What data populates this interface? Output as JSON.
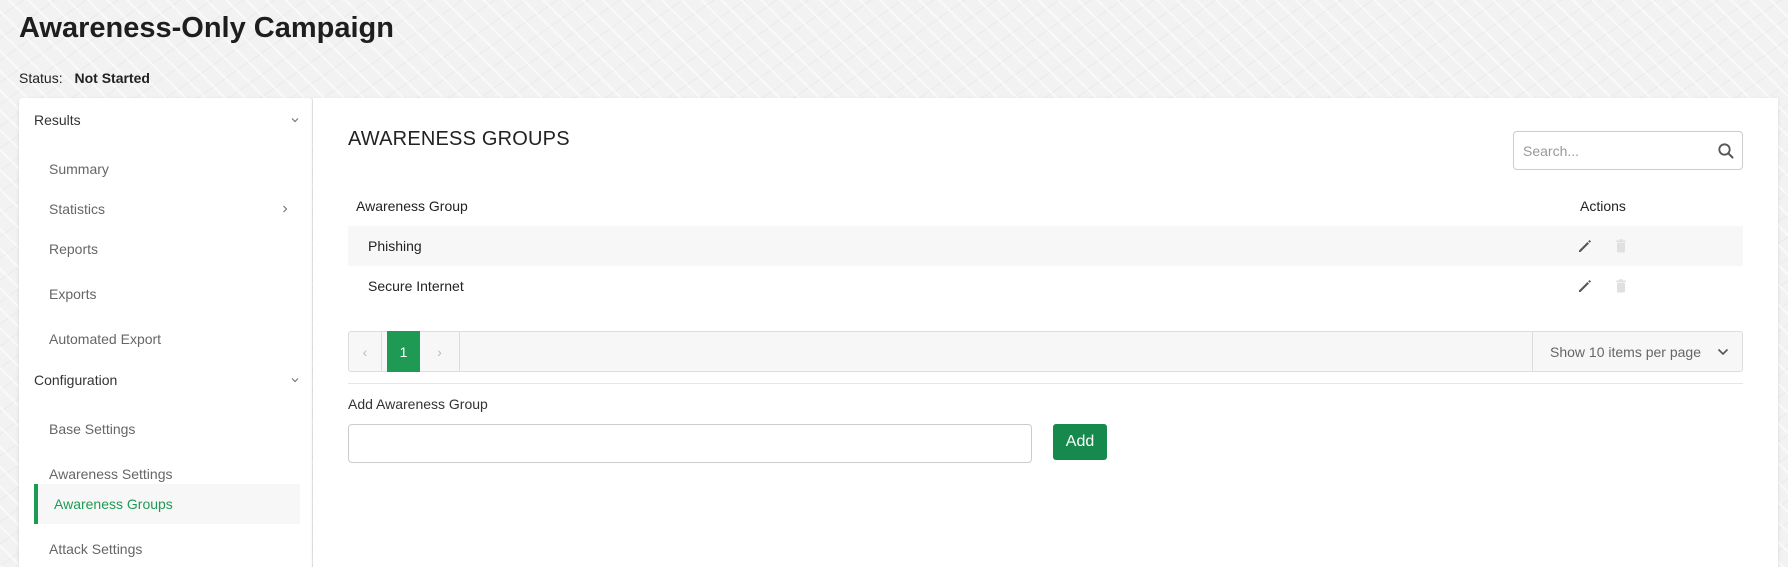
{
  "page": {
    "title": "Awareness-Only Campaign",
    "status_label": "Status:",
    "status_value": "Not Started"
  },
  "sidebar": {
    "groups": [
      {
        "label": "Results",
        "items": [
          {
            "label": "Summary"
          },
          {
            "label": "Statistics",
            "has_submenu": true
          },
          {
            "label": "Reports"
          },
          {
            "label": "Exports"
          },
          {
            "label": "Automated Export"
          }
        ]
      },
      {
        "label": "Configuration",
        "items": [
          {
            "label": "Base Settings"
          },
          {
            "label": "Awareness Settings"
          },
          {
            "label": "Awareness Groups",
            "active": true
          },
          {
            "label": "Attack Settings"
          }
        ]
      }
    ]
  },
  "main": {
    "section_title": "AWARENESS GROUPS",
    "search": {
      "placeholder": "Search...",
      "value": ""
    },
    "table": {
      "columns": [
        "Awareness Group",
        "Actions"
      ],
      "rows": [
        {
          "name": "Phishing"
        },
        {
          "name": "Secure Internet"
        }
      ]
    },
    "pagination": {
      "prev": "‹",
      "current_page": "1",
      "next": "›",
      "page_size_label": "Show 10 items per page"
    },
    "add_form": {
      "label": "Add Awareness Group",
      "input_value": "",
      "button_label": "Add"
    }
  },
  "colors": {
    "accent": "#1f9a55",
    "button": "#158a4c"
  },
  "icons": {
    "search": "search-icon",
    "edit": "pencil-icon",
    "delete": "trash-icon",
    "chevron_down": "chevron-down-icon",
    "chevron_right": "chevron-right-icon"
  }
}
